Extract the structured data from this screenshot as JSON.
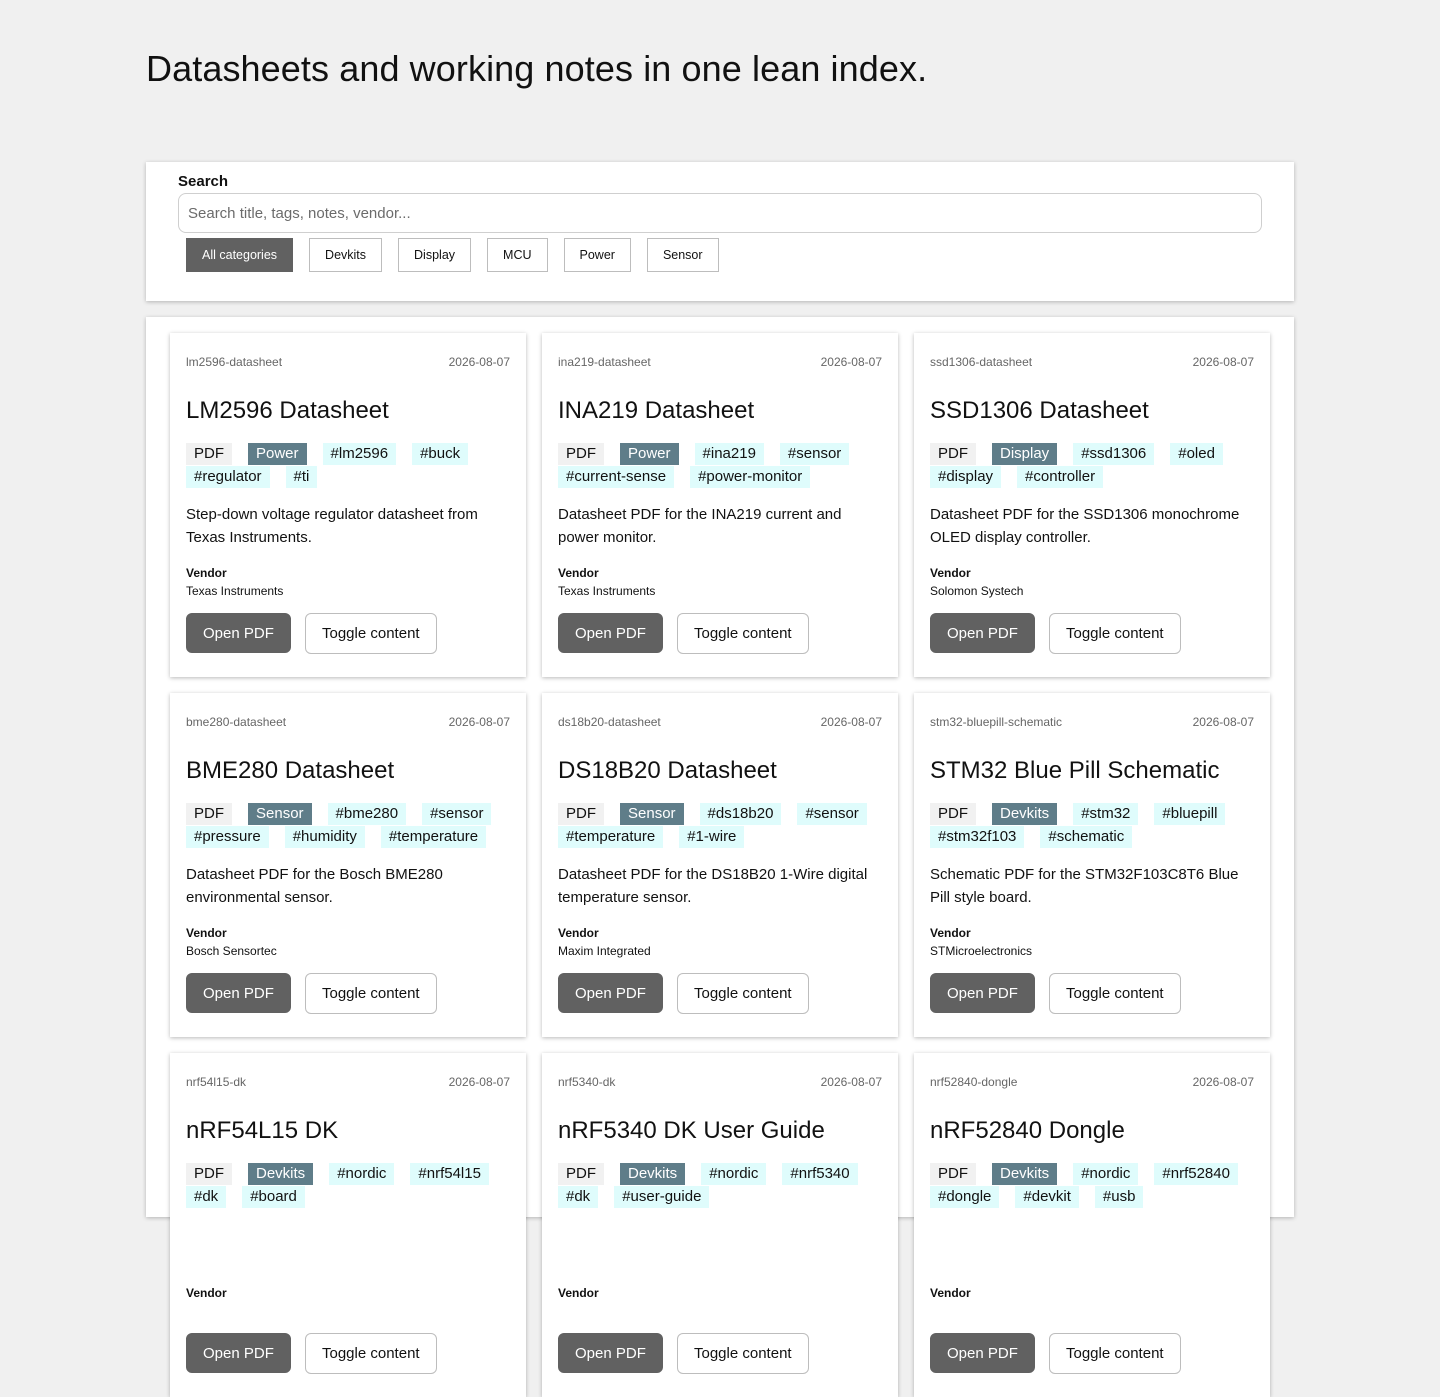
{
  "page": {
    "title": "Datasheets and working notes in one lean index."
  },
  "search": {
    "label": "Search",
    "placeholder": "Search title, tags, notes, vendor...",
    "value": ""
  },
  "filters": [
    {
      "label": "All categories",
      "active": true
    },
    {
      "label": "Devkits",
      "active": false
    },
    {
      "label": "Display",
      "active": false
    },
    {
      "label": "MCU",
      "active": false
    },
    {
      "label": "Power",
      "active": false
    },
    {
      "label": "Sensor",
      "active": false
    }
  ],
  "colors": {
    "background": "#f0f0f0",
    "primary_button": "#616161",
    "category_tag": "#5f7d89",
    "keyword_tag": "#dffcfc",
    "type_tag": "#f1f1f1"
  },
  "labels": {
    "vendor": "Vendor",
    "open": "Open PDF",
    "toggle": "Toggle content"
  },
  "cards": [
    {
      "slug": "lm2596-datasheet",
      "date": "2026-08-07",
      "title": "LM2596 Datasheet",
      "type": "PDF",
      "category": "Power",
      "tags": [
        "#lm2596",
        "#buck",
        "#regulator",
        "#ti"
      ],
      "description": "Step-down voltage regulator datasheet from Texas Instruments.",
      "vendor": "Texas Instruments"
    },
    {
      "slug": "ina219-datasheet",
      "date": "2026-08-07",
      "title": "INA219 Datasheet",
      "type": "PDF",
      "category": "Power",
      "tags": [
        "#ina219",
        "#sensor",
        "#current-sense",
        "#power-monitor"
      ],
      "description": "Datasheet PDF for the INA219 current and power monitor.",
      "vendor": "Texas Instruments"
    },
    {
      "slug": "ssd1306-datasheet",
      "date": "2026-08-07",
      "title": "SSD1306 Datasheet",
      "type": "PDF",
      "category": "Display",
      "tags": [
        "#ssd1306",
        "#oled",
        "#display",
        "#controller"
      ],
      "description": "Datasheet PDF for the SSD1306 monochrome OLED display controller.",
      "vendor": "Solomon Systech"
    },
    {
      "slug": "bme280-datasheet",
      "date": "2026-08-07",
      "title": "BME280 Datasheet",
      "type": "PDF",
      "category": "Sensor",
      "tags": [
        "#bme280",
        "#sensor",
        "#pressure",
        "#humidity",
        "#temperature"
      ],
      "description": "Datasheet PDF for the Bosch BME280 environmental sensor.",
      "vendor": "Bosch Sensortec"
    },
    {
      "slug": "ds18b20-datasheet",
      "date": "2026-08-07",
      "title": "DS18B20 Datasheet",
      "type": "PDF",
      "category": "Sensor",
      "tags": [
        "#ds18b20",
        "#sensor",
        "#temperature",
        "#1-wire"
      ],
      "description": "Datasheet PDF for the DS18B20 1-Wire digital temperature sensor.",
      "vendor": "Maxim Integrated"
    },
    {
      "slug": "stm32-bluepill-schematic",
      "date": "2026-08-07",
      "title": "STM32 Blue Pill Schematic",
      "type": "PDF",
      "category": "Devkits",
      "tags": [
        "#stm32",
        "#bluepill",
        "#stm32f103",
        "#schematic"
      ],
      "description": "Schematic PDF for the STM32F103C8T6 Blue Pill style board.",
      "vendor": "STMicroelectronics"
    },
    {
      "slug": "nrf54l15-dk",
      "date": "2026-08-07",
      "title": "nRF54L15 DK",
      "type": "PDF",
      "category": "Devkits",
      "tags": [
        "#nordic",
        "#nrf54l15",
        "#dk",
        "#board"
      ],
      "description": "",
      "vendor": ""
    },
    {
      "slug": "nrf5340-dk",
      "date": "2026-08-07",
      "title": "nRF5340 DK User Guide",
      "type": "PDF",
      "category": "Devkits",
      "tags": [
        "#nordic",
        "#nrf5340",
        "#dk",
        "#user-guide"
      ],
      "description": "",
      "vendor": ""
    },
    {
      "slug": "nrf52840-dongle",
      "date": "2026-08-07",
      "title": "nRF52840 Dongle",
      "type": "PDF",
      "category": "Devkits",
      "tags": [
        "#nordic",
        "#nrf52840",
        "#dongle",
        "#devkit",
        "#usb"
      ],
      "description": "",
      "vendor": ""
    }
  ]
}
